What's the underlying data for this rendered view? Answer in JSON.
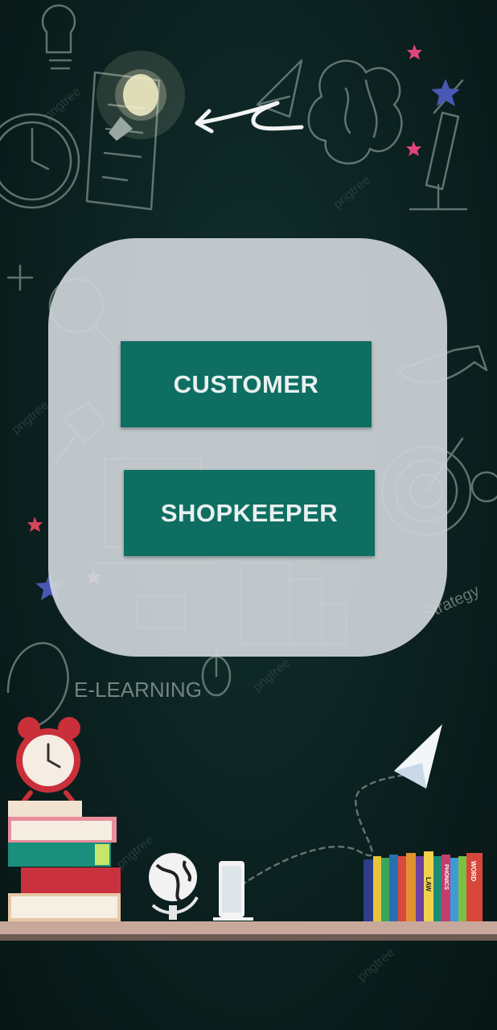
{
  "background": {
    "doodle_text": "E-LEARNING",
    "watermark": "pngtree",
    "strategy_text": "Strategy",
    "book_spines": [
      "WORD",
      "PHONICS",
      "LAW"
    ],
    "colors": {
      "chalkboard": "#0b2120",
      "shelf": "#c7a89a",
      "doodle_stroke": "#7d8f8d"
    }
  },
  "panel": {
    "customer_label": "CUSTOMER",
    "shopkeeper_label": "SHOPKEEPER",
    "button_color": "#0e6e62",
    "panel_color": "#cdd3d7"
  }
}
